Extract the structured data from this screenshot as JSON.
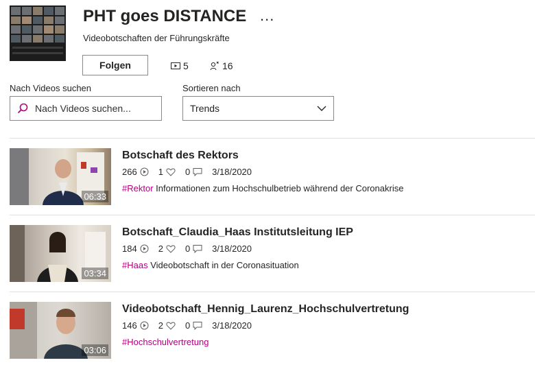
{
  "channel": {
    "title": "PHT goes DISTANCE",
    "more_label": "...",
    "subtitle": "Videobotschaften der Führungskräfte",
    "follow_label": "Folgen",
    "video_count": "5",
    "follower_count": "16"
  },
  "search": {
    "label": "Nach Videos suchen",
    "placeholder": "Nach Videos suchen..."
  },
  "sort": {
    "label": "Sortieren nach",
    "selected": "Trends"
  },
  "videos": [
    {
      "title": "Botschaft des Rektors",
      "duration": "06:33",
      "views": "266",
      "likes": "1",
      "comments": "0",
      "date": "3/18/2020",
      "tag": "#Rektor",
      "description": " Informationen zum Hochschulbetrieb während der Coronakrise"
    },
    {
      "title": "Botschaft_Claudia_Haas Institutsleitung IEP",
      "duration": "03:34",
      "views": "184",
      "likes": "2",
      "comments": "0",
      "date": "3/18/2020",
      "tag": "#Haas",
      "description": " Videobotschaft in der Coronasituation"
    },
    {
      "title": "Videobotschaft_Hennig_Laurenz_Hochschulvertretung",
      "duration": "03:06",
      "views": "146",
      "likes": "2",
      "comments": "0",
      "date": "3/18/2020",
      "tag": "#Hochschulvertretung",
      "description": ""
    }
  ],
  "colors": {
    "accent": "#b4007f",
    "text": "#252423",
    "border": "#8a8886"
  },
  "icons": [
    "search-icon",
    "chevron-down-icon",
    "video-count-icon",
    "followers-icon",
    "views-icon",
    "likes-icon",
    "comments-icon"
  ]
}
